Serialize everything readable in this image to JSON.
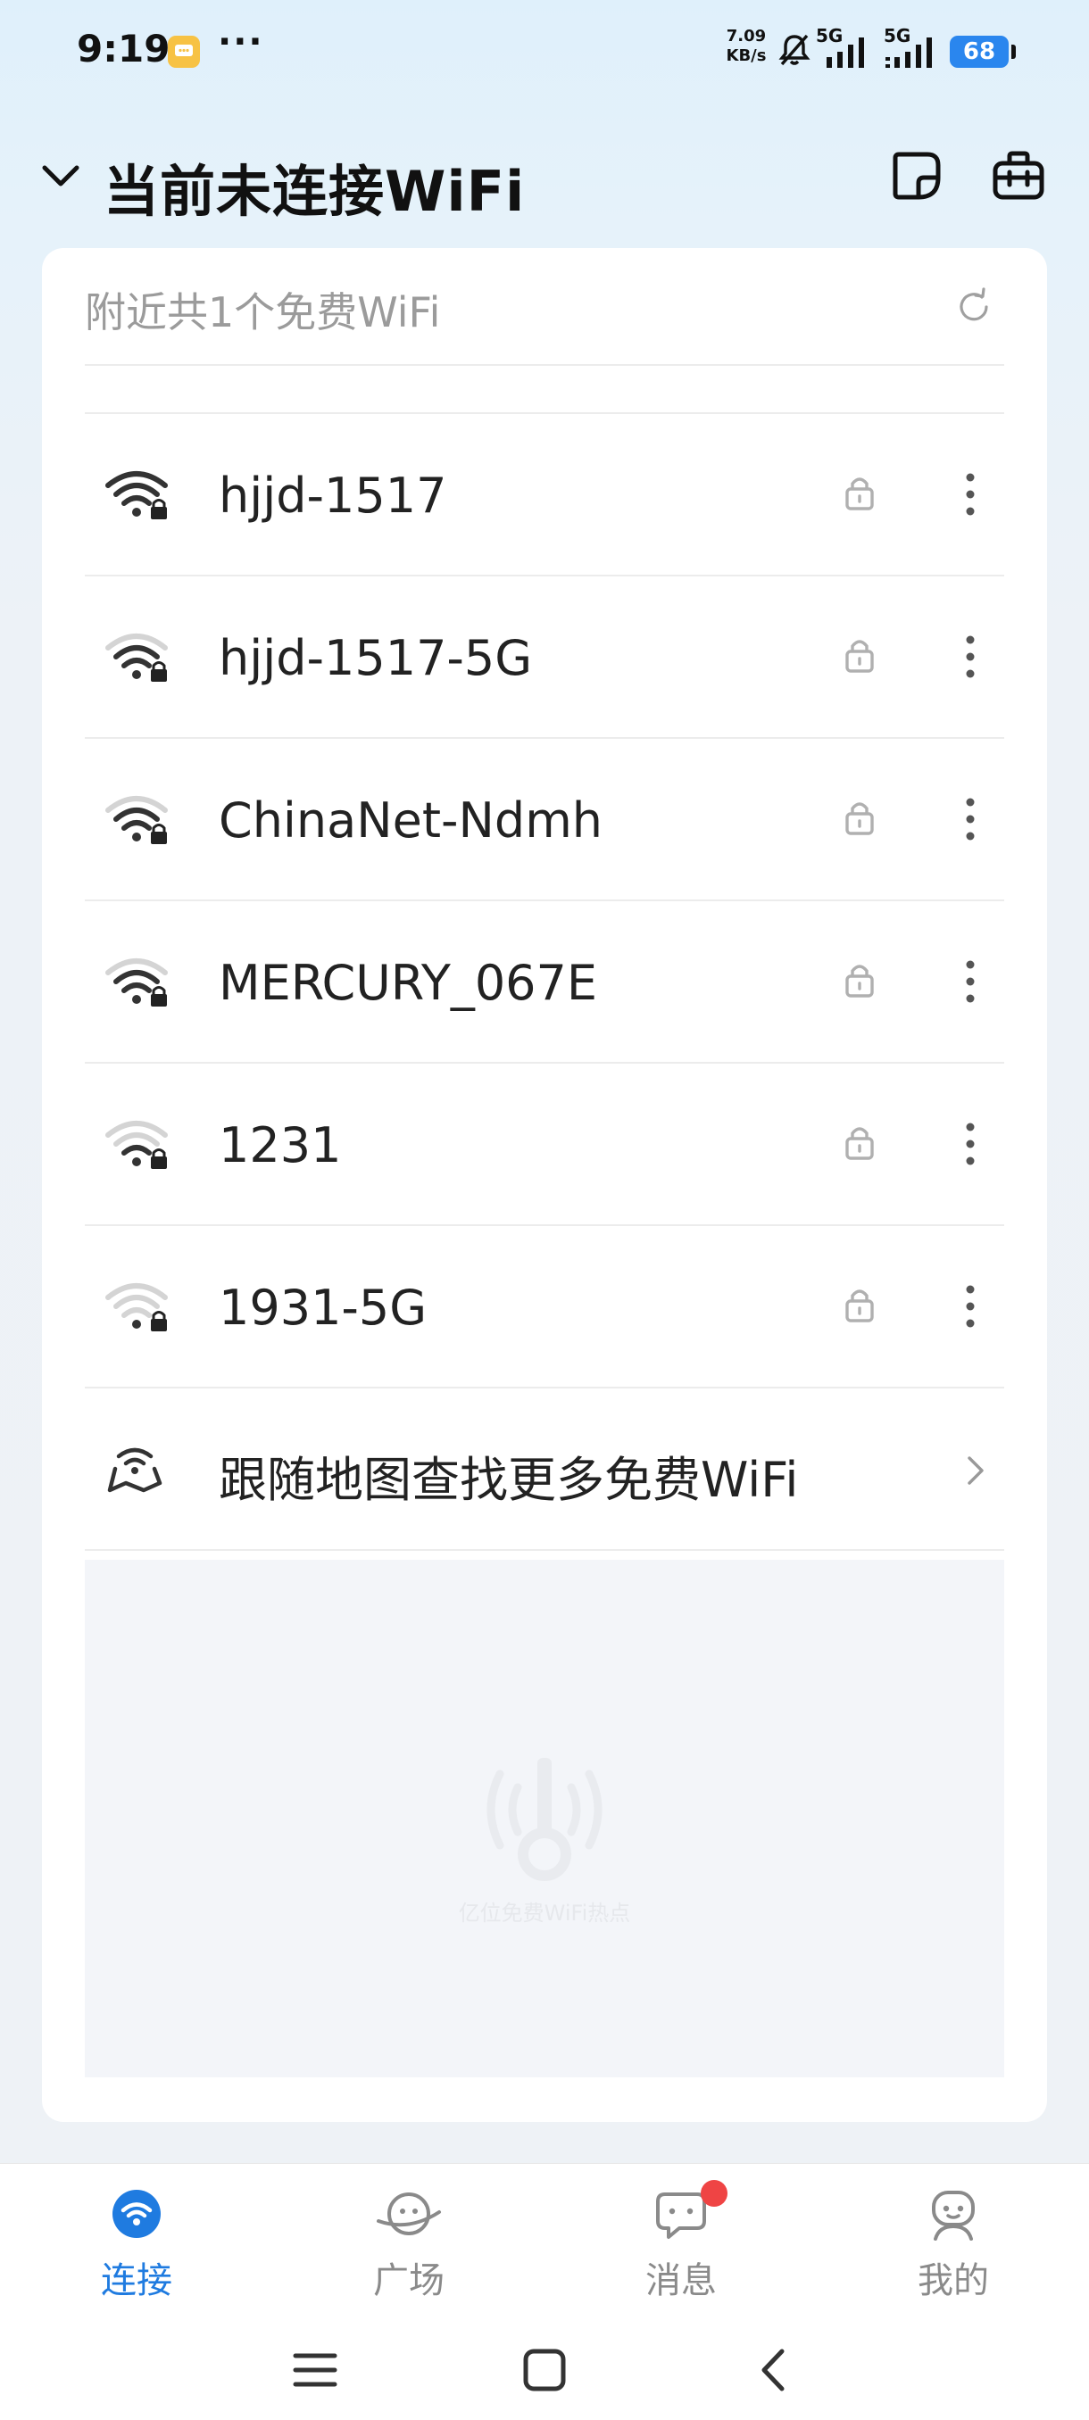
{
  "status_bar": {
    "time": "9:19",
    "more": "···",
    "speed_value": "7.09",
    "speed_unit": "KB/s",
    "network_a": "5G",
    "network_b": "5G",
    "battery": "68"
  },
  "header": {
    "title": "当前未连接WiFi"
  },
  "nearby": {
    "text": "附近共1个免费WiFi"
  },
  "wifi_networks": [
    {
      "name": "hjjd-1517",
      "signal": 4
    },
    {
      "name": "hjjd-1517-5G",
      "signal": 3
    },
    {
      "name": "ChinaNet-Ndmh",
      "signal": 3
    },
    {
      "name": "MERCURY_067E",
      "signal": 3
    },
    {
      "name": "1231",
      "signal": 2
    },
    {
      "name": "1931-5G",
      "signal": 1
    }
  ],
  "map_link": {
    "text": "跟随地图查找更多免费WiFi"
  },
  "ad": {
    "caption": "亿位免费WiFi热点"
  },
  "bottom_nav": [
    {
      "label": "连接",
      "active": true
    },
    {
      "label": "广场",
      "active": false
    },
    {
      "label": "消息",
      "active": false,
      "badge": true
    },
    {
      "label": "我的",
      "active": false
    }
  ],
  "colors": {
    "accent": "#1f7be0",
    "badge": "#ef4444",
    "battery": "#2a86ee"
  }
}
